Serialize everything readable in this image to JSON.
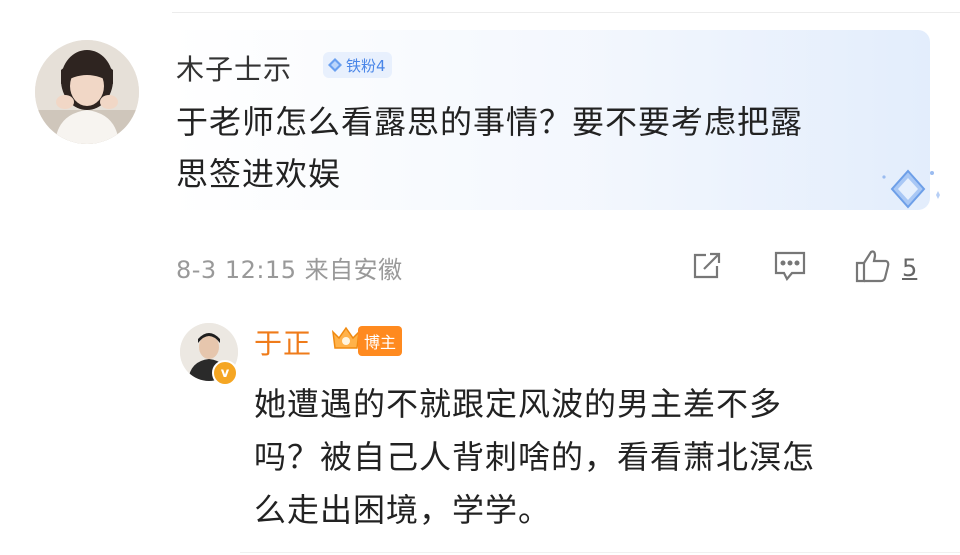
{
  "comment": {
    "username": "木子士示",
    "fan_badge": "铁粉4",
    "text_lines": [
      "于老师怎么看露思的事情？要不要考虑把露",
      "思签进欢娱"
    ],
    "meta": "8-3 12:15 来自安徽",
    "like_count": "5",
    "icons": {
      "share": "share-icon",
      "reply": "comment-icon",
      "like": "thumbs-up-icon",
      "badge": "diamond-icon"
    }
  },
  "reply": {
    "username": "于正",
    "badge_label": "博主",
    "verified_mark": "v",
    "text_lines": [
      "她遭遇的不就跟定风波的男主差不多",
      "吗？被自己人背刺啥的，看看萧北溟怎",
      "么走出困境，学学。"
    ],
    "icons": {
      "verified": "verified-v-icon",
      "crown": "crown-icon"
    }
  },
  "colors": {
    "username_reply": "#ef7b1a",
    "badge_blue": "#4a86e8",
    "badge_orange": "#ff8a1f",
    "meta_gray": "#999999"
  }
}
